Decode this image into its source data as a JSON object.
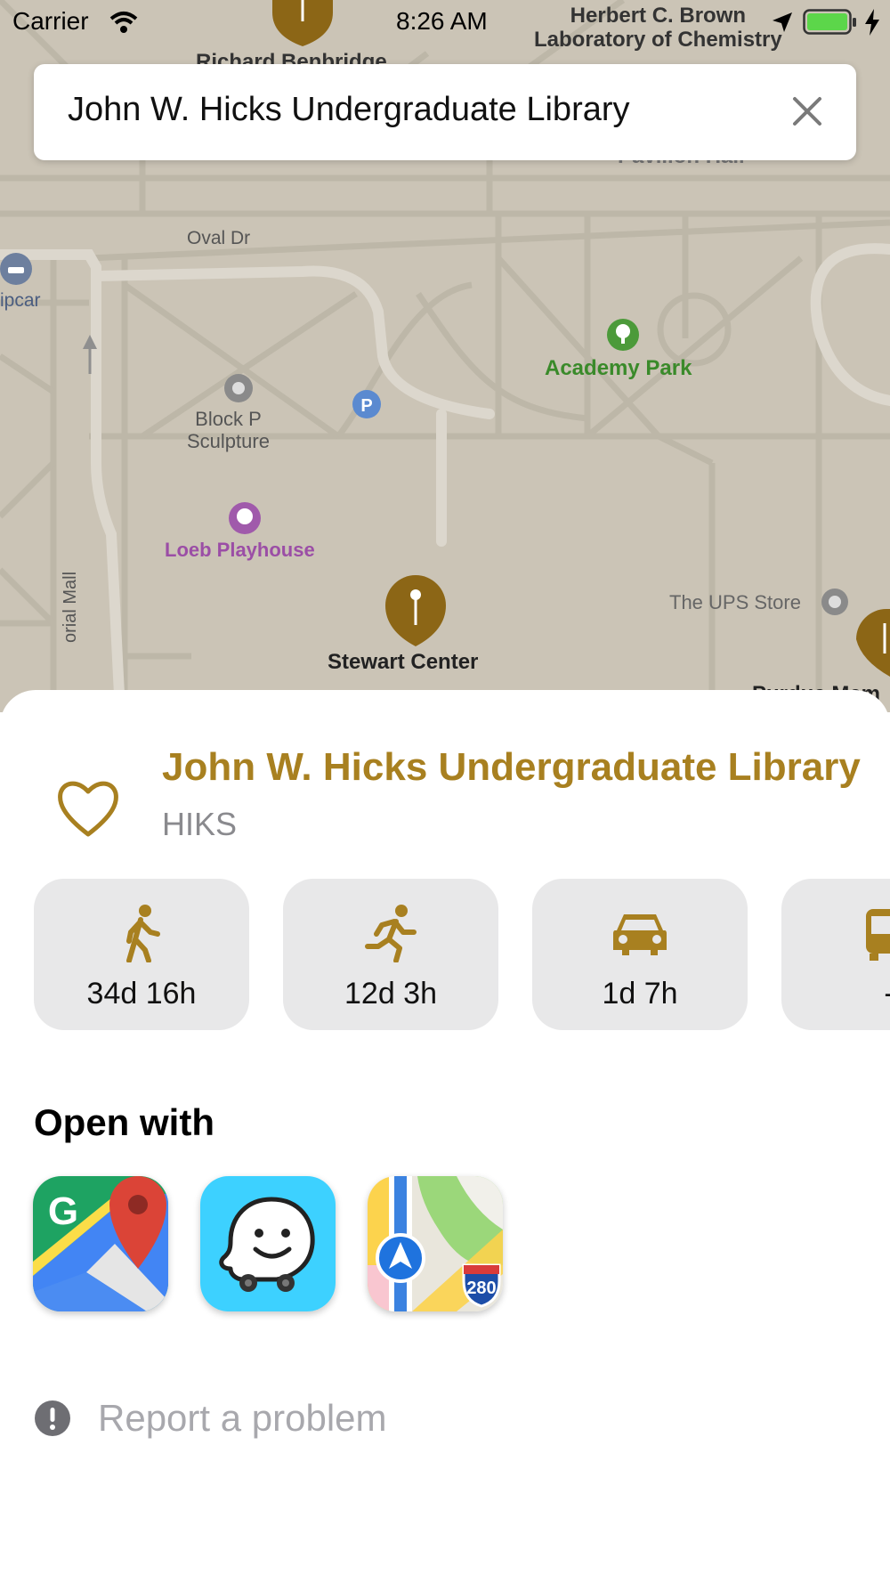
{
  "status_bar": {
    "carrier": "Carrier",
    "time": "8:26 AM",
    "location_label": [
      "Herbert C. Brown",
      "Laboratory of Chemistry"
    ]
  },
  "search": {
    "value": "John W. Hicks Undergraduate Library",
    "clear_icon": "close-icon"
  },
  "map": {
    "labels": {
      "richard": "Richard Benbridge",
      "pavilion": "Pavilion Hall",
      "oval": "Oval Dr",
      "zipcar": "ipcar",
      "academy": "Academy Park",
      "block_p_1": "Block P",
      "block_p_2": "Sculpture",
      "loeb": "Loeb Playhouse",
      "ups": "The UPS Store",
      "stewart": "Stewart Center",
      "mall": "orial Mall",
      "edge": "Purdue Mem"
    },
    "colors": {
      "background": "#cbc4b6",
      "road": "#d9d4ca",
      "pin": "#8c6616"
    }
  },
  "sheet": {
    "title": "John W. Hicks Undergraduate Library",
    "code": "HIKS",
    "accent_color": "#a88020",
    "favorite_icon": "heart-icon",
    "travel": [
      {
        "mode": "walk",
        "icon": "walking-icon",
        "time": "34d 16h"
      },
      {
        "mode": "run",
        "icon": "running-icon",
        "time": "12d 3h"
      },
      {
        "mode": "car",
        "icon": "car-icon",
        "time": "1d 7h"
      },
      {
        "mode": "bus",
        "icon": "bus-icon",
        "time": "-"
      }
    ],
    "open_with_title": "Open with",
    "apps": [
      {
        "name": "Google Maps",
        "icon": "google-maps-icon"
      },
      {
        "name": "Waze",
        "icon": "waze-icon"
      },
      {
        "name": "Apple Maps",
        "icon": "apple-maps-icon"
      }
    ],
    "apple_maps_shield": "280",
    "report_label": "Report a problem"
  }
}
